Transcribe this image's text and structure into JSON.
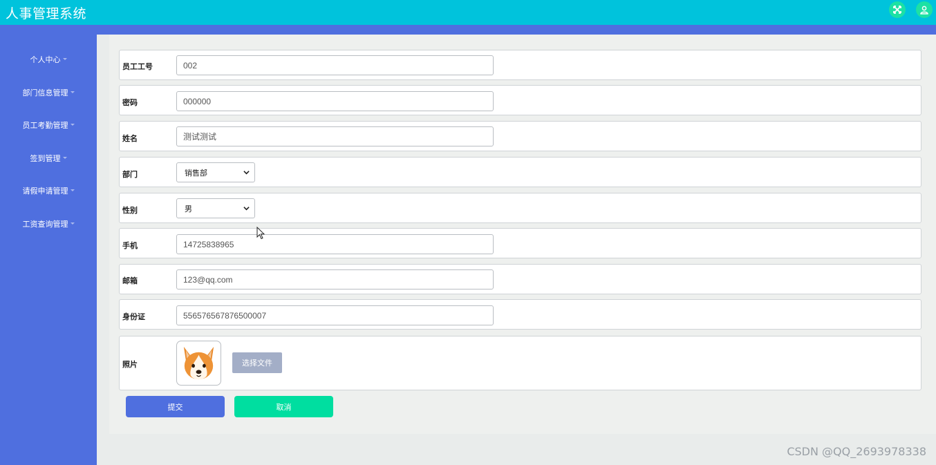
{
  "app": {
    "title": "人事管理系统"
  },
  "header": {
    "icons": [
      "fullscreen-icon",
      "user-icon"
    ],
    "accent": "#00c3dc"
  },
  "sidebar": {
    "bg": "#4f6fdf",
    "items": [
      {
        "label": "个人中心"
      },
      {
        "label": "部门信息管理"
      },
      {
        "label": "员工考勤管理"
      },
      {
        "label": "签到管理"
      },
      {
        "label": "请假申请管理"
      },
      {
        "label": "工资查询管理"
      }
    ]
  },
  "form": {
    "employee_id": {
      "label": "员工工号",
      "value": "002"
    },
    "password": {
      "label": "密码",
      "value": "000000"
    },
    "name": {
      "label": "姓名",
      "value": "测试测试"
    },
    "department": {
      "label": "部门",
      "selected": "销售部"
    },
    "gender": {
      "label": "性别",
      "selected": "男"
    },
    "phone": {
      "label": "手机",
      "value": "14725838965"
    },
    "email": {
      "label": "邮箱",
      "value": "123@qq.com"
    },
    "id_card": {
      "label": "身份证",
      "value": "556576567876500007"
    },
    "photo": {
      "label": "照片",
      "choose_file": "选择文件"
    }
  },
  "actions": {
    "submit": "提交",
    "cancel": "取消",
    "submit_color": "#4f6fdf",
    "cancel_color": "#00dea0"
  },
  "watermark": "CSDN @QQ_2693978338"
}
